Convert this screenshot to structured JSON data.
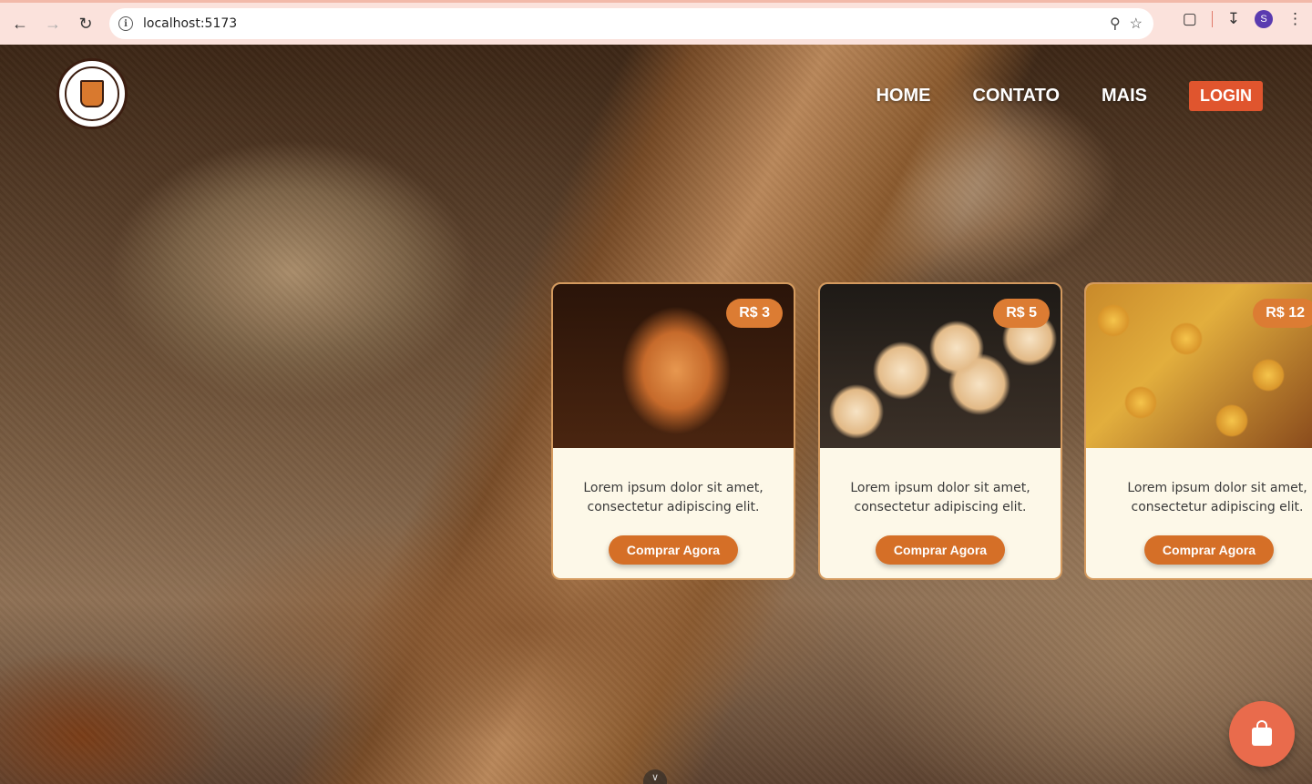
{
  "browser": {
    "url": "localhost:5173",
    "profile_initial": "S",
    "icons": [
      "back-icon",
      "forward-icon",
      "reload-icon",
      "info-icon",
      "zoom-icon",
      "star-icon",
      "extensions-icon",
      "download-icon",
      "more-icon"
    ]
  },
  "site": {
    "logo_alt": "TRADIÇÃO NO FORNO",
    "nav": {
      "home": "HOME",
      "contato": "CONTATO",
      "mais": "MAIS",
      "login": "LOGIN"
    }
  },
  "products": [
    {
      "price": "R$ 3",
      "description": "Lorem ipsum dolor sit amet, consectetur adipiscing elit.",
      "button": "Comprar Agora"
    },
    {
      "price": "R$ 5",
      "description": "Lorem ipsum dolor sit amet, consectetur adipiscing elit.",
      "button": "Comprar Agora"
    },
    {
      "price": "R$ 12",
      "description": "Lorem ipsum dolor sit amet, consectetur adipiscing elit.",
      "button": "Comprar Agora"
    }
  ],
  "colors": {
    "accent": "#d56f27",
    "login": "#e0552e",
    "cart": "#e96b4c",
    "card_bg": "#fdf8e8"
  },
  "cart": {
    "icon": "shopping-bag-icon"
  }
}
